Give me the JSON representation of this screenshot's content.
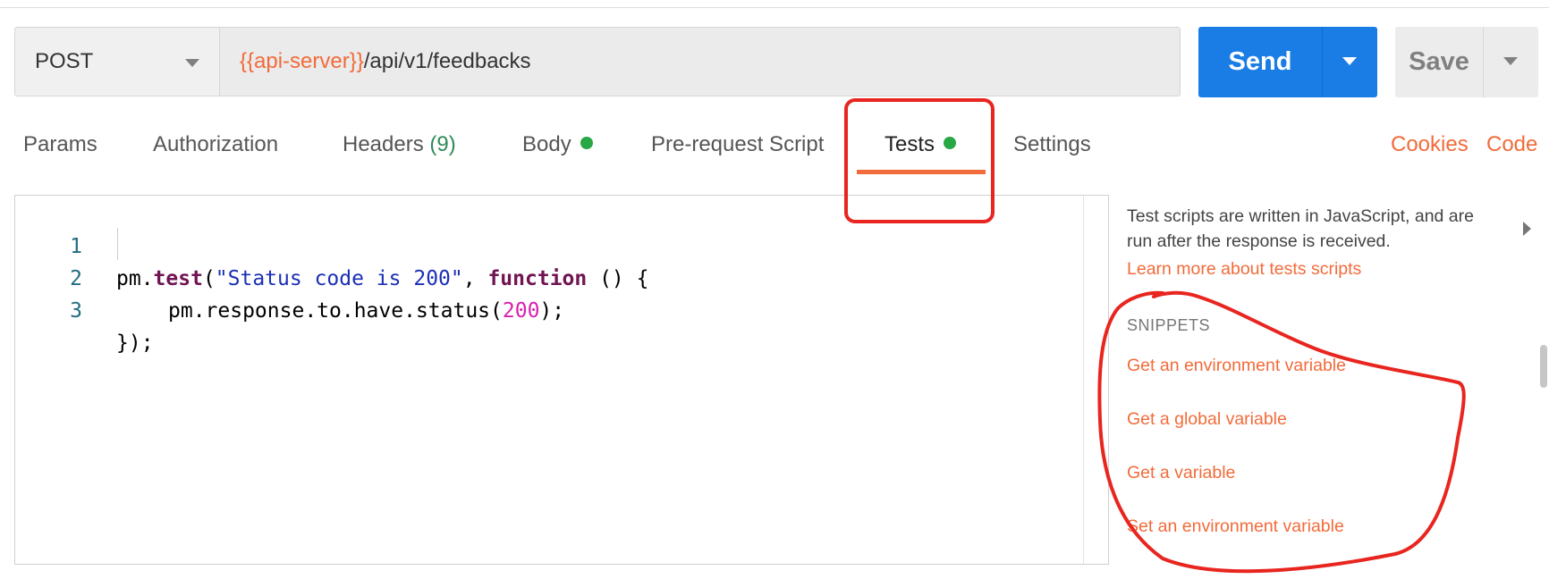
{
  "request": {
    "method": "POST",
    "url_variable": "{{api-server}}",
    "url_path": "/api/v1/feedbacks",
    "send_label": "Send",
    "save_label": "Save"
  },
  "tabs": [
    {
      "label": "Params"
    },
    {
      "label": "Authorization"
    },
    {
      "label": "Headers",
      "count": "(9)"
    },
    {
      "label": "Body"
    },
    {
      "label": "Pre-request Script"
    },
    {
      "label": "Tests"
    },
    {
      "label": "Settings"
    }
  ],
  "right_links": {
    "cookies": "Cookies",
    "code": "Code"
  },
  "editor": {
    "line_numbers": [
      "1",
      "2",
      "3"
    ],
    "line1": {
      "obj": "pm.",
      "fn": "test",
      "open": "(",
      "str": "\"Status code is 200\"",
      "comma": ", ",
      "kw": "function",
      "rest": " () {"
    },
    "line2": {
      "pre": "pm.response.to.have.status(",
      "num": "200",
      "post": ");"
    },
    "line3": {
      "text": "});"
    }
  },
  "side_panel": {
    "description": "Test scripts are written in JavaScript, and are run after the response is received.",
    "learn_more": "Learn more about tests scripts",
    "snippets_heading": "SNIPPETS",
    "snippets": [
      "Get an environment variable",
      "Get a global variable",
      "Get a variable",
      "Set an environment variable"
    ]
  },
  "colors": {
    "accent_orange": "#f26b3a",
    "send_blue": "#1a7de6",
    "status_green": "#28a745",
    "annotation_red": "#e8251f"
  }
}
